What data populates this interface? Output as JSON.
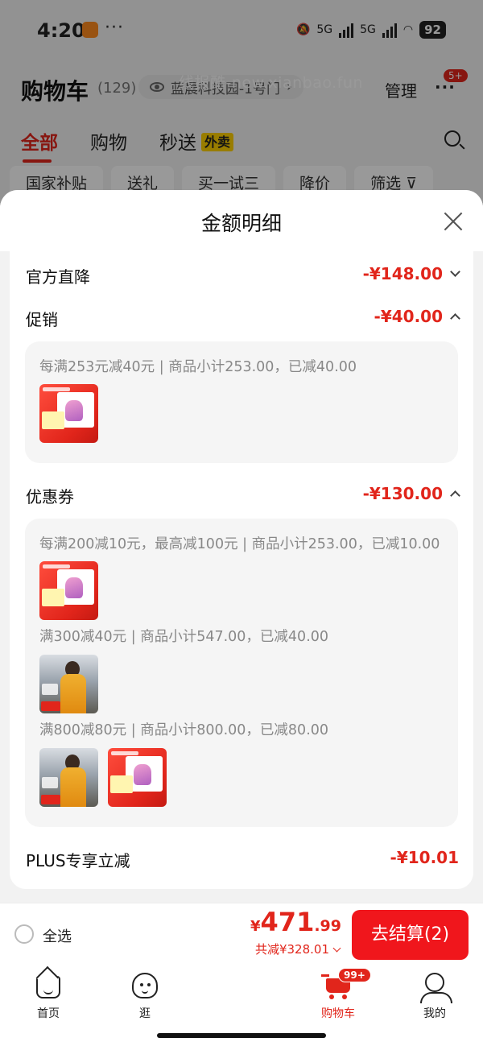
{
  "status_bar": {
    "time": "4:20",
    "more": "···",
    "network_1": "5G",
    "network_2": "5G",
    "battery": "92"
  },
  "header": {
    "title": "购物车",
    "count": "(129)",
    "address": "蓝晨科技园-1号门",
    "watermark": "线报酷-new.xianbao.fun",
    "manage": "管理",
    "more": "···",
    "message_badge": "5+"
  },
  "tabs": [
    {
      "label": "全部"
    },
    {
      "label": "购物"
    },
    {
      "label": "秒送"
    }
  ],
  "tab_tag": "外卖",
  "filters": [
    {
      "label": "国家补贴"
    },
    {
      "label": "送礼"
    },
    {
      "label": "买一试三"
    },
    {
      "label": "降价"
    },
    {
      "label": "筛选 ⊽"
    }
  ],
  "sheet": {
    "title": "金额明细",
    "rows": {
      "official": {
        "label": "官方直降",
        "amount": "-¥148.00"
      },
      "promo": {
        "label": "促销",
        "amount": "-¥40.00"
      },
      "coupon": {
        "label": "优惠券",
        "amount": "-¥130.00"
      },
      "plus": {
        "label": "PLUS专享立减",
        "amount": "-¥10.01"
      }
    },
    "promo_rule": "每满253元减40元 | 商品小计253.00，已减40.00",
    "coupon_rules": [
      "每满200减10元，最高减100元 | 商品小计253.00，已减10.00",
      "满300减40元 | 商品小计547.00，已减40.00",
      "满800减80元 | 商品小计800.00，已减80.00"
    ]
  },
  "checkout": {
    "select_all": "全选",
    "yen": "¥",
    "total_int": "471",
    "total_dec": ".99",
    "saved": "共减¥328.01",
    "button": "去结算(2)"
  },
  "nav": [
    {
      "label": "首页",
      "icon": "home-icon"
    },
    {
      "label": "逛",
      "icon": "browse-icon"
    },
    {
      "label": "购物车",
      "icon": "cart-icon",
      "badge": "99+"
    },
    {
      "label": "我的",
      "icon": "me-icon"
    }
  ],
  "colors": {
    "accent": "#e1251b",
    "button": "#f0161c"
  }
}
